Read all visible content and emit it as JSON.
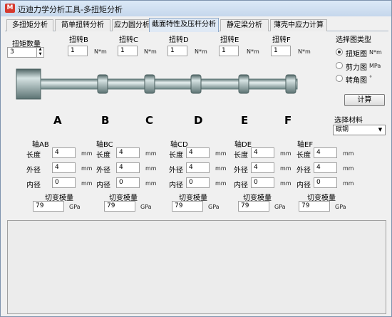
{
  "window": {
    "title": "迈迪力学分析工具-多扭矩分析"
  },
  "tabs": [
    {
      "label": "多扭矩分析"
    },
    {
      "label": "简单扭转分析"
    },
    {
      "label": "应力圆分析"
    },
    {
      "label": "截面特性及压杆分析"
    },
    {
      "label": "静定梁分析"
    },
    {
      "label": "薄壳中应力计算"
    }
  ],
  "torque": {
    "count_label": "扭矩数量",
    "count_value": "3",
    "items": [
      {
        "label": "扭转B",
        "value": "1",
        "unit": "N*m"
      },
      {
        "label": "扭转C",
        "value": "1",
        "unit": "N*m"
      },
      {
        "label": "扭转D",
        "value": "1",
        "unit": "N*m"
      },
      {
        "label": "扭转E",
        "value": "1",
        "unit": "N*m"
      },
      {
        "label": "扭转F",
        "value": "1",
        "unit": "N*m"
      }
    ]
  },
  "diagram": {
    "type_label": "选择图类型",
    "options": [
      {
        "label": "扭矩图",
        "unit": "N*m",
        "selected": true
      },
      {
        "label": "剪力图",
        "unit": "MPa",
        "selected": false
      },
      {
        "label": "转角图",
        "unit": "°",
        "selected": false
      }
    ]
  },
  "calc_button": "计算",
  "points": [
    "A",
    "B",
    "C",
    "D",
    "E",
    "F"
  ],
  "material": {
    "label": "选择材料",
    "value": "碳钢"
  },
  "segments": [
    {
      "title": "轴AB",
      "length": "4",
      "outer": "4",
      "inner": "0",
      "modulus": "79"
    },
    {
      "title": "轴BC",
      "length": "4",
      "outer": "4",
      "inner": "0",
      "modulus": "79"
    },
    {
      "title": "轴CD",
      "length": "4",
      "outer": "4",
      "inner": "0",
      "modulus": "79"
    },
    {
      "title": "轴DE",
      "length": "4",
      "outer": "4",
      "inner": "0",
      "modulus": "79"
    },
    {
      "title": "轴EF",
      "length": "4",
      "outer": "4",
      "inner": "0",
      "modulus": "79"
    }
  ],
  "field_labels": {
    "length": "长度",
    "outer": "外径",
    "inner": "内径",
    "modulus": "切变模量"
  },
  "units": {
    "length": "mm",
    "modulus": "GPa"
  },
  "colors": {
    "shaft": "#8fa6a6",
    "shaft_highlight": "#e8f0f0",
    "active_tab": "#dfe9f5"
  }
}
